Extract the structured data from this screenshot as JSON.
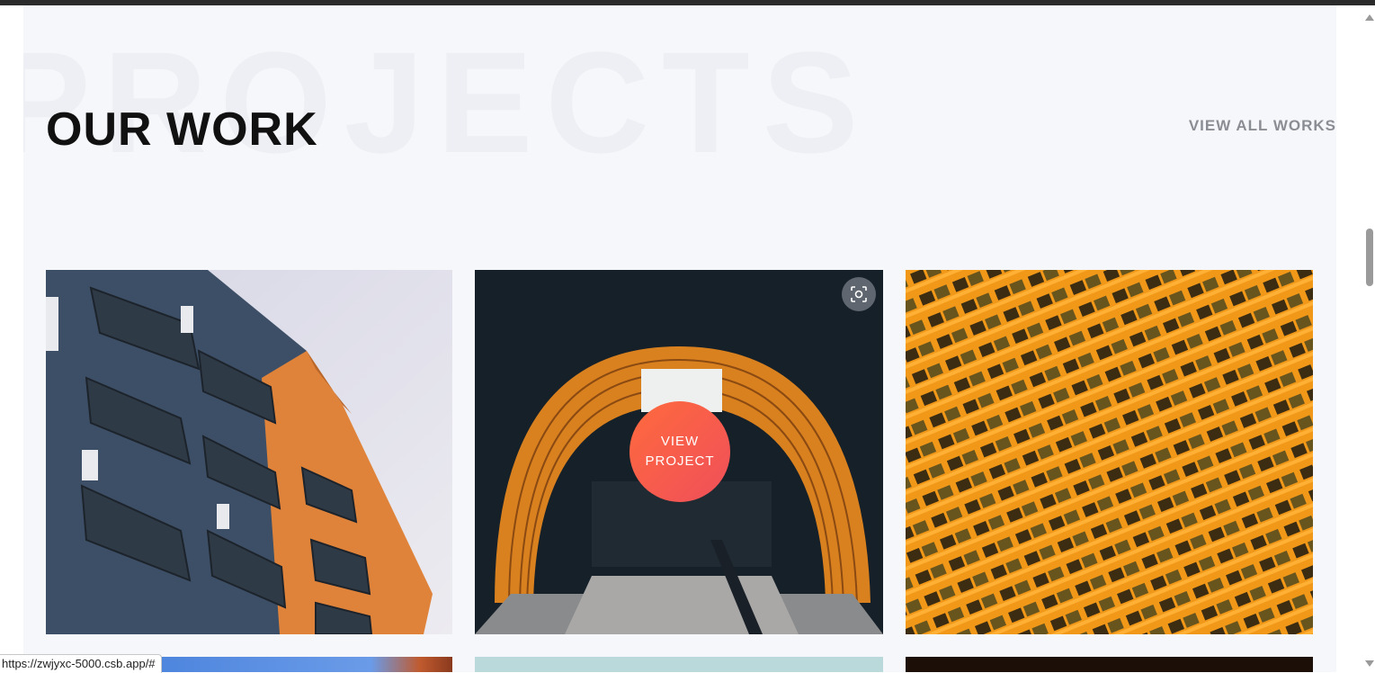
{
  "section": {
    "background_word": "PROJECTS",
    "title": "OUR WORK",
    "view_all_label": "VIEW ALL WORKS"
  },
  "cards": [
    {
      "overlay_label": ""
    },
    {
      "overlay_label": "VIEW\nPROJECT",
      "zoom_icon": "zoom-focus-icon"
    },
    {
      "overlay_label": ""
    }
  ],
  "status_bar": {
    "url": "https://zwjyxc-5000.csb.app/#"
  },
  "colors": {
    "accent": "#f4603f",
    "title": "#111111",
    "link": "#8a8d93",
    "section_bg": "#f6f7fa"
  }
}
